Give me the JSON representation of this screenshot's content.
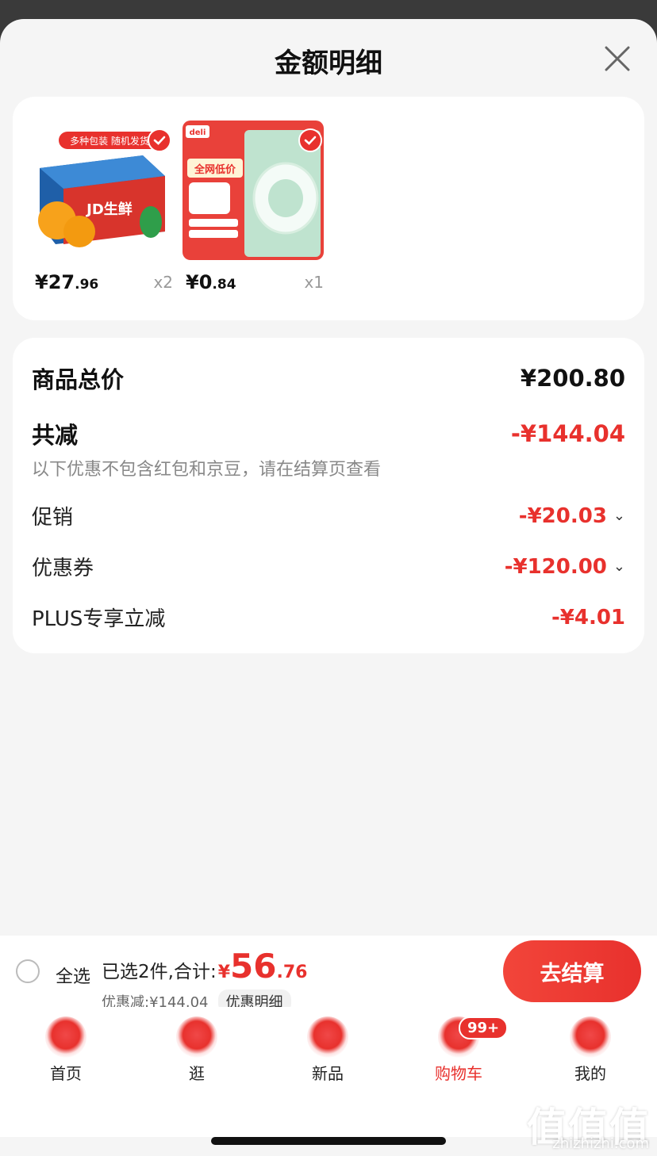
{
  "header": {
    "title": "金额明细"
  },
  "products": [
    {
      "price_int": "¥27",
      "price_dec": ".96",
      "qty": "x2",
      "badge_text": "多种包装 随机发货",
      "brand_text": "JD生鲜"
    },
    {
      "price_int": "¥0",
      "price_dec": ".84",
      "qty": "x1",
      "brand_text": "deli",
      "promo_text": "全网低价"
    }
  ],
  "summary": {
    "total_label": "商品总价",
    "total_value": "¥200.80",
    "reduce_label": "共减",
    "reduce_value": "-¥144.04",
    "reduce_note": "以下优惠不包含红包和京豆，请在结算页查看",
    "promo_label": "促销",
    "promo_value": "-¥20.03",
    "coupon_label": "优惠券",
    "coupon_value": "-¥120.00",
    "plus_label": "PLUS专享立减",
    "plus_value": "-¥4.01"
  },
  "bottom": {
    "select_all": "全选",
    "selected_text": "已选2件,合计:",
    "yen": "¥",
    "amount_int": "56",
    "amount_dec": ".76",
    "discount_text": "优惠减:¥144.04",
    "detail_chip": "优惠明细",
    "checkout": "去结算"
  },
  "tabs": [
    {
      "label": "首页",
      "icon": "home-icon"
    },
    {
      "label": "逛",
      "icon": "browse-icon"
    },
    {
      "label": "新品",
      "icon": "new-box-icon"
    },
    {
      "label": "购物车",
      "icon": "cart-icon",
      "badge": "99+"
    },
    {
      "label": "我的",
      "icon": "profile-icon"
    }
  ],
  "watermark": {
    "text": "值值值",
    "url": "zhizhizhi.com"
  },
  "colors": {
    "accent": "#e8312d",
    "background": "#f5f5f5"
  }
}
